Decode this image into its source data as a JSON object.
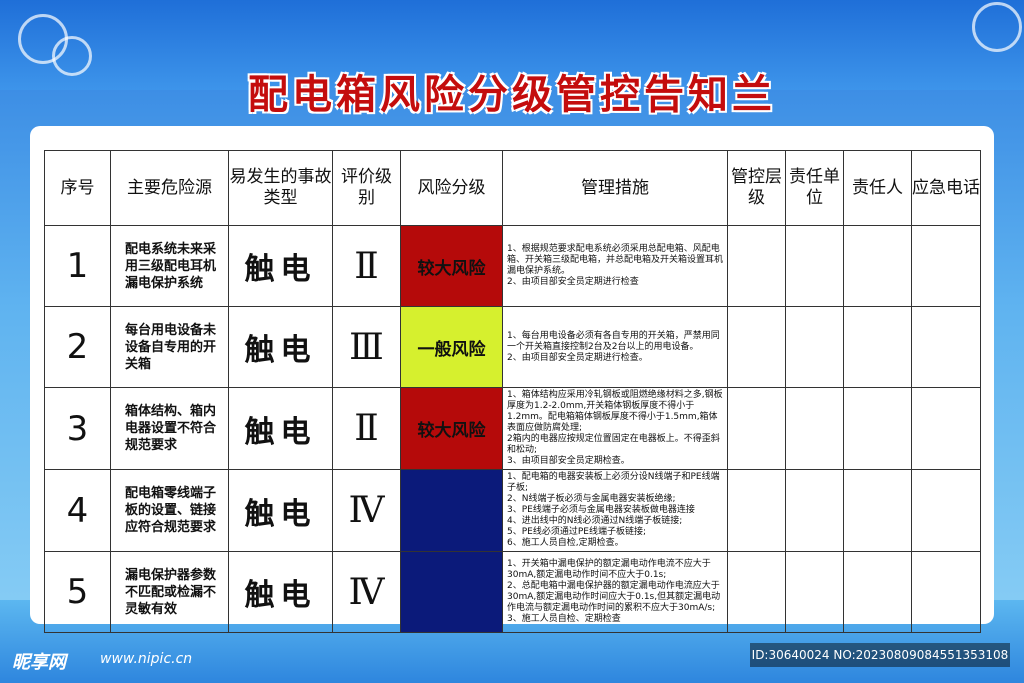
{
  "title": "配电箱风险分级管控告知兰",
  "headers": [
    "序号",
    "主要危险源",
    "易发生的事故类型",
    "评价级别",
    "风险分级",
    "管理措施",
    "管控层级",
    "责任单位",
    "责任人",
    "应急电话"
  ],
  "rows": [
    {
      "no": "1",
      "hazard": "配电系统未来采用三级配电耳机漏电保护系统",
      "accident": "触电",
      "level": "Ⅱ",
      "risk": "较大风险",
      "risk_color": "#b50a0a",
      "measures": "1、根据规范要求配电系统必须采用总配电箱、风配电箱、开关箱三级配电箱，并总配电箱及开关箱设置耳机漏电保护系统。\n2、由项目部安全员定期进行检查"
    },
    {
      "no": "2",
      "hazard": "每台用电设备未设备自专用的开关箱",
      "accident": "触电",
      "level": "Ⅲ",
      "risk": "一般风险",
      "risk_color": "#d6f02e",
      "measures": "1、每台用电设备必须有各自专用的开关箱，严禁用同一个开关箱直接控制2台及2台以上的用电设备。\n2、由项目部安全员定期进行检查。"
    },
    {
      "no": "3",
      "hazard": "箱体结构、箱内电器设置不符合规范要求",
      "accident": "触电",
      "level": "Ⅱ",
      "risk": "较大风险",
      "risk_color": "#b50a0a",
      "measures": "1、箱体结构应采用冷轧钢板或阻燃绝缘材料之多,钢板厚度为1.2-2.0mm,开关箱体钢板厚度不得小于1.2mm。配电箱箱体钢板厚度不得小于1.5mm,箱体表面应做防腐处理;\n2箱内的电器应按规定位置固定在电器板上。不得歪斜和松动;\n3、由项目部安全员定期检查。"
    },
    {
      "no": "4",
      "hazard": "配电箱零线端子板的设置、链接应符合规范要求",
      "accident": "触电",
      "level": "Ⅳ",
      "risk": "",
      "risk_color": "#0b1a7a",
      "measures": "1、配电箱的电器安装板上必须分设N线端子和PE线端子板;\n2、N线端子板必须与金属电器安装板绝缘;\n3、PE线端子必须与金属电器安装板做电器连接\n4、进出线中的N线必须通过N线端子板链接;\n5、PE线必须通过PE线端子板链接;\n6、施工人员自检,定期检查。"
    },
    {
      "no": "5",
      "hazard": "漏电保护器参数不匹配或检漏不灵敏有效",
      "accident": "触电",
      "level": "Ⅳ",
      "risk": "",
      "risk_color": "#0b1a7a",
      "measures": "1、开关箱中漏电保护的额定漏电动作电流不应大于30mA,额定漏电动作时间不应大于0.1s;\n2、总配电箱中漏电保护器的额定漏电动作电流应大于30mA,额定漏电动作时间应大于0.1s,但其额定漏电动作电流与额定漏电动作时间的累积不应大于30mA/s;\n3、施工人员自检、定期检查"
    }
  ],
  "footer": {
    "logo": "昵享网",
    "url": "www.nipic.cn",
    "id": "ID:30640024 NO:20230809084551353108"
  }
}
